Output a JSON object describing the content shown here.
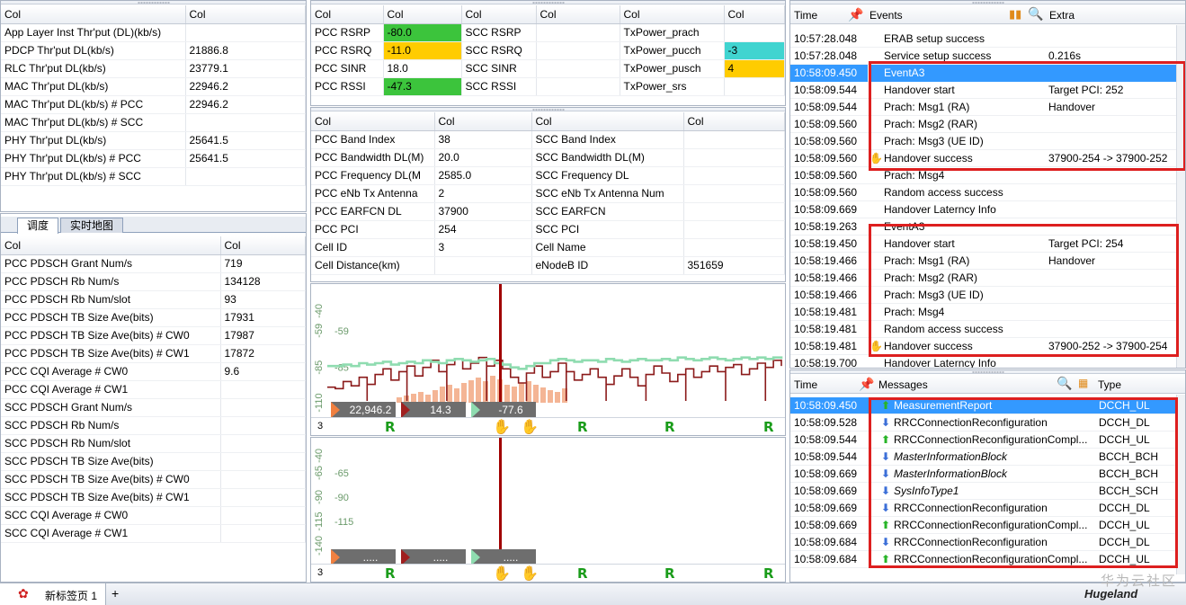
{
  "top_left": {
    "headers": [
      "Col",
      "Col"
    ],
    "rows": [
      [
        "App Layer Inst Thr'put (DL)(kb/s)",
        ""
      ],
      [
        "PDCP Thr'put DL(kb/s)",
        "21886.8"
      ],
      [
        "RLC Thr'put DL(kb/s)",
        "23779.1"
      ],
      [
        "MAC Thr'put DL(kb/s)",
        "22946.2"
      ],
      [
        "MAC Thr'put DL(kb/s) # PCC",
        "22946.2"
      ],
      [
        "MAC Thr'put DL(kb/s) # SCC",
        ""
      ],
      [
        "PHY Thr'put DL(kb/s)",
        "25641.5"
      ],
      [
        "PHY Thr'put DL(kb/s) # PCC",
        "25641.5"
      ],
      [
        "PHY Thr'put DL(kb/s) # SCC",
        ""
      ]
    ]
  },
  "tabs": [
    {
      "label": "调度",
      "active": true
    },
    {
      "label": "实时地图",
      "active": false
    }
  ],
  "sched": {
    "headers": [
      "Col",
      "Col"
    ],
    "rows": [
      [
        "PCC PDSCH Grant Num/s",
        "719"
      ],
      [
        "PCC PDSCH Rb Num/s",
        "134128"
      ],
      [
        "PCC PDSCH Rb Num/slot",
        "93"
      ],
      [
        "PCC PDSCH TB Size Ave(bits)",
        "17931"
      ],
      [
        "PCC PDSCH TB Size Ave(bits) # CW0",
        "17987"
      ],
      [
        "PCC PDSCH TB Size Ave(bits) # CW1",
        "17872"
      ],
      [
        "PCC CQI Average # CW0",
        "9.6"
      ],
      [
        "PCC CQI Average # CW1",
        ""
      ],
      [
        "SCC PDSCH Grant Num/s",
        ""
      ],
      [
        "SCC PDSCH Rb Num/s",
        ""
      ],
      [
        "SCC PDSCH Rb Num/slot",
        ""
      ],
      [
        "SCC PDSCH TB Size Ave(bits)",
        ""
      ],
      [
        "SCC PDSCH TB Size Ave(bits) # CW0",
        ""
      ],
      [
        "SCC PDSCH TB Size Ave(bits) # CW1",
        ""
      ],
      [
        "SCC CQI Average # CW0",
        ""
      ],
      [
        "SCC CQI Average # CW1",
        ""
      ]
    ]
  },
  "radio": {
    "headers": [
      "Col",
      "Col",
      "Col",
      "Col",
      "Col",
      "Col"
    ],
    "rows": [
      [
        {
          "t": "PCC RSRP"
        },
        {
          "t": "-80.0",
          "c": "green"
        },
        {
          "t": "SCC RSRP"
        },
        {
          "t": ""
        },
        {
          "t": "TxPower_prach"
        },
        {
          "t": ""
        }
      ],
      [
        {
          "t": "PCC RSRQ"
        },
        {
          "t": "-11.0",
          "c": "yellow"
        },
        {
          "t": "SCC RSRQ"
        },
        {
          "t": ""
        },
        {
          "t": "TxPower_pucch"
        },
        {
          "t": "-3",
          "c": "cyan"
        }
      ],
      [
        {
          "t": "PCC SINR"
        },
        {
          "t": "18.0"
        },
        {
          "t": "SCC SINR"
        },
        {
          "t": ""
        },
        {
          "t": "TxPower_pusch"
        },
        {
          "t": "4",
          "c": "yellow"
        }
      ],
      [
        {
          "t": "PCC RSSI"
        },
        {
          "t": "-47.3",
          "c": "green"
        },
        {
          "t": "SCC RSSI"
        },
        {
          "t": ""
        },
        {
          "t": "TxPower_srs"
        },
        {
          "t": ""
        }
      ]
    ]
  },
  "cell": {
    "headers": [
      "Col",
      "Col",
      "Col",
      "Col"
    ],
    "rows": [
      [
        "PCC Band Index",
        "38",
        "SCC Band Index",
        ""
      ],
      [
        "PCC Bandwidth DL(M)",
        "20.0",
        "SCC Bandwidth DL(M)",
        ""
      ],
      [
        "PCC Frequency DL(M",
        "2585.0",
        "SCC Frequency DL",
        ""
      ],
      [
        "PCC eNb Tx Antenna",
        "2",
        "SCC eNb Tx Antenna Num",
        ""
      ],
      [
        "PCC EARFCN DL",
        "37900",
        "SCC EARFCN",
        ""
      ],
      [
        "PCC PCI",
        "254",
        "SCC PCI",
        ""
      ],
      [
        "Cell ID",
        "3",
        "Cell Name",
        ""
      ],
      [
        "Cell Distance(km)",
        "",
        "eNodeB ID",
        "351659"
      ]
    ]
  },
  "chart_data": [
    {
      "type": "line",
      "yticks": [
        "-40",
        "-59",
        "-85",
        "-110"
      ],
      "ylim": [
        -110,
        -40
      ],
      "series": [
        {
          "values": [
            -99,
            -100,
            -95,
            -98,
            -92,
            -97,
            -90,
            -86,
            -94,
            -88,
            -84,
            -91,
            -85,
            -80,
            -88,
            -83,
            -79,
            -86,
            -82,
            -78,
            -84,
            -80,
            -86,
            -92,
            -96,
            -89,
            -84,
            -92,
            -88,
            -82,
            -88,
            -94,
            -90,
            -86,
            -92,
            -97,
            -91,
            -86,
            -92,
            -98,
            -90,
            -84,
            -89,
            -95,
            -90,
            -86,
            -92,
            -88,
            -84,
            -88,
            -85,
            -83,
            -90,
            -86,
            -82,
            -85,
            -80,
            -84
          ]
        },
        {
          "values": [
            -84,
            -84,
            -83,
            -84,
            -82,
            -83,
            -82,
            -81,
            -83,
            -82,
            -81,
            -82,
            -80,
            -81,
            -82,
            -80,
            -79,
            -80,
            -81,
            -80,
            -79,
            -82,
            -83,
            -85,
            -86,
            -84,
            -82,
            -82,
            -80,
            -79,
            -80,
            -81,
            -80,
            -80,
            -81,
            -79,
            -80,
            -81,
            -80,
            -79,
            -80,
            -80,
            -79,
            -80,
            -78,
            -79,
            -80,
            -79,
            -78,
            -79,
            -80,
            -79,
            -78,
            -79,
            -78,
            -79,
            -78,
            -79
          ]
        }
      ],
      "markers": [
        "22,946.2",
        "14.3",
        "-77.6"
      ],
      "footer_index": "3"
    },
    {
      "type": "line",
      "yticks": [
        "-40",
        "-65",
        "-90",
        "-115",
        "-140"
      ],
      "ylim": [
        -140,
        -40
      ],
      "series": [],
      "markers": [
        ".....",
        ".....",
        "....."
      ],
      "footer_index": "3"
    }
  ],
  "events": {
    "headers": {
      "time": "Time",
      "events": "Events",
      "extra": "Extra"
    },
    "rows": [
      {
        "time": "10:57:28.048",
        "event": "ERAB setup success",
        "extra": ""
      },
      {
        "time": "10:57:28.048",
        "event": "Service setup success",
        "extra": "0.216s"
      },
      {
        "time": "10:58:09.450",
        "event": "EventA3",
        "extra": "",
        "sel": true
      },
      {
        "time": "10:58:09.544",
        "event": "Handover start",
        "extra": "Target PCI: 252"
      },
      {
        "time": "10:58:09.544",
        "event": "Prach: Msg1 (RA)",
        "extra": "Handover"
      },
      {
        "time": "10:58:09.560",
        "event": "Prach: Msg2 (RAR)",
        "extra": ""
      },
      {
        "time": "10:58:09.560",
        "event": "Prach: Msg3 (UE ID)",
        "extra": ""
      },
      {
        "time": "10:58:09.560",
        "event": "Handover success",
        "extra": "37900-254 -> 37900-252",
        "icon": true
      },
      {
        "time": "10:58:09.560",
        "event": "Prach: Msg4",
        "extra": ""
      },
      {
        "time": "10:58:09.560",
        "event": "Random access success",
        "extra": ""
      },
      {
        "time": "10:58:09.669",
        "event": "Handover Laterncy Info",
        "extra": ""
      },
      {
        "time": "10:58:19.263",
        "event": "EventA3",
        "extra": ""
      },
      {
        "time": "10:58:19.450",
        "event": "Handover start",
        "extra": "Target PCI: 254"
      },
      {
        "time": "10:58:19.466",
        "event": "Prach: Msg1 (RA)",
        "extra": "Handover"
      },
      {
        "time": "10:58:19.466",
        "event": "Prach: Msg2 (RAR)",
        "extra": ""
      },
      {
        "time": "10:58:19.466",
        "event": "Prach: Msg3 (UE ID)",
        "extra": ""
      },
      {
        "time": "10:58:19.481",
        "event": "Prach: Msg4",
        "extra": ""
      },
      {
        "time": "10:58:19.481",
        "event": "Random access success",
        "extra": ""
      },
      {
        "time": "10:58:19.481",
        "event": "Handover success",
        "extra": "37900-252 -> 37900-254",
        "icon": true
      },
      {
        "time": "10:58:19.700",
        "event": "Handover Laterncy Info",
        "extra": ""
      }
    ]
  },
  "messages": {
    "headers": {
      "time": "Time",
      "messages": "Messages",
      "type": "Type"
    },
    "rows": [
      {
        "time": "10:58:09.450",
        "dir": "up",
        "msg": "MeasurementReport",
        "type": "DCCH_UL",
        "sel": true
      },
      {
        "time": "10:58:09.528",
        "dir": "down",
        "msg": "RRCConnectionReconfiguration",
        "type": "DCCH_DL"
      },
      {
        "time": "10:58:09.544",
        "dir": "up",
        "msg": "RRCConnectionReconfigurationCompl...",
        "type": "DCCH_UL"
      },
      {
        "time": "10:58:09.544",
        "dir": "down",
        "msg": "MasterInformationBlock",
        "type": "BCCH_BCH",
        "italic": true
      },
      {
        "time": "10:58:09.669",
        "dir": "down",
        "msg": "MasterInformationBlock",
        "type": "BCCH_BCH",
        "italic": true
      },
      {
        "time": "10:58:09.669",
        "dir": "down",
        "msg": "SysInfoType1",
        "type": "BCCH_SCH",
        "italic": true
      },
      {
        "time": "10:58:09.669",
        "dir": "down",
        "msg": "RRCConnectionReconfiguration",
        "type": "DCCH_DL"
      },
      {
        "time": "10:58:09.669",
        "dir": "up",
        "msg": "RRCConnectionReconfigurationCompl...",
        "type": "DCCH_UL"
      },
      {
        "time": "10:58:09.684",
        "dir": "down",
        "msg": "RRCConnectionReconfiguration",
        "type": "DCCH_DL"
      },
      {
        "time": "10:58:09.684",
        "dir": "up",
        "msg": "RRCConnectionReconfigurationCompl...",
        "type": "DCCH_UL"
      }
    ]
  },
  "statusbar": {
    "tab_label": "新标签页 1",
    "add_label": "+"
  },
  "watermark": {
    "cn": "华为云社区",
    "brand": "Hugeland"
  },
  "colors": {
    "selection": "#3399ff",
    "highlight_box": "#dd1f1f",
    "rsrp_line": "#8b1a1a",
    "sinr_line": "#8fdcb0"
  }
}
